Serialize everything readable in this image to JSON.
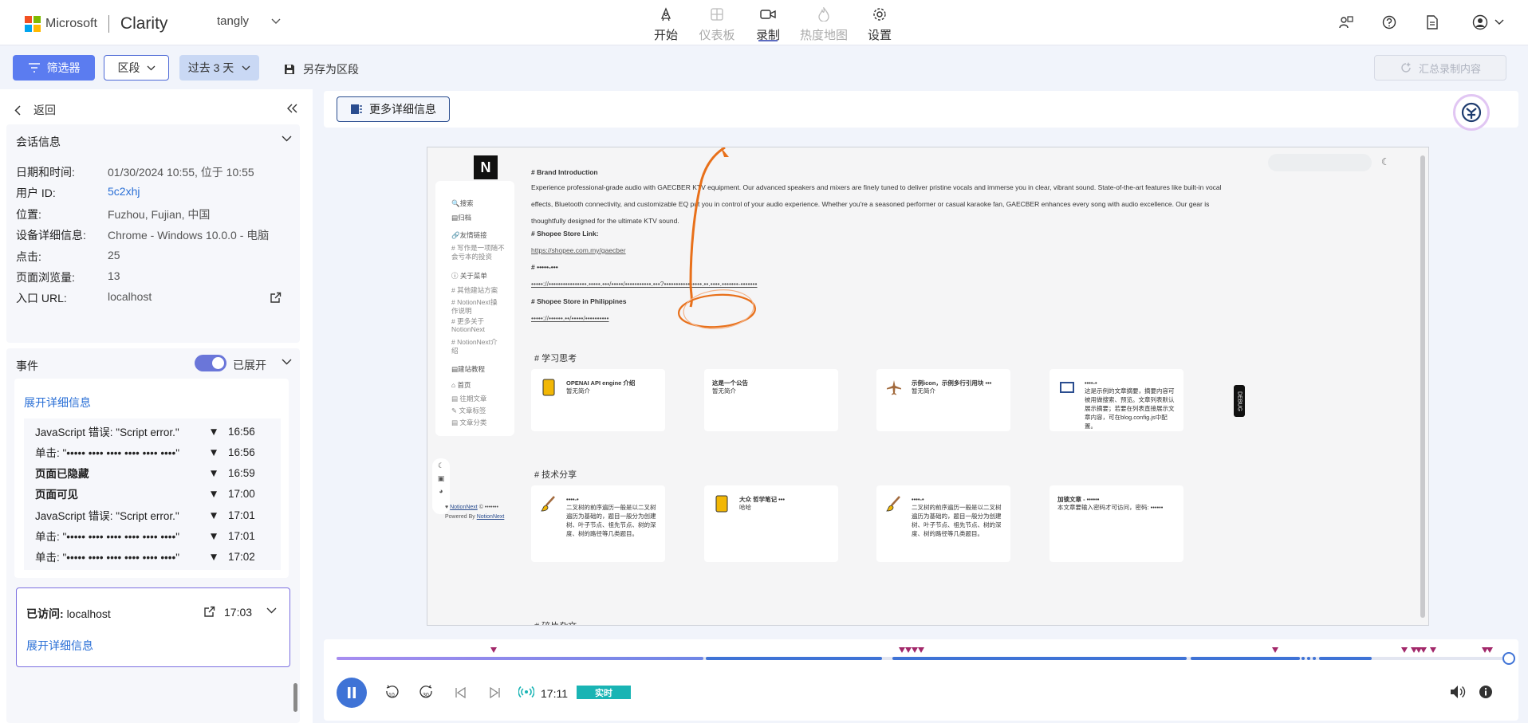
{
  "header": {
    "brand": "Microsoft",
    "product": "Clarity",
    "project": "tangly",
    "nav": [
      {
        "label": "开始",
        "icon": "rocket-icon",
        "state": "normal"
      },
      {
        "label": "仪表板",
        "icon": "dashboard-icon",
        "state": "disabled"
      },
      {
        "label": "录制",
        "icon": "video-icon",
        "state": "active"
      },
      {
        "label": "热度地图",
        "icon": "flame-icon",
        "state": "disabled"
      },
      {
        "label": "设置",
        "icon": "gear-icon",
        "state": "normal"
      }
    ]
  },
  "toolbar": {
    "filter": "筛选器",
    "segment": "区段",
    "range": "过去 3 天",
    "save_segment": "另存为区段",
    "summarize": "汇总录制内容"
  },
  "sidebar": {
    "back": "返回",
    "session_title": "会话信息",
    "session": [
      {
        "k": "日期和时间:",
        "v": "01/30/2024 10:55, 位于 10:55",
        "link": false
      },
      {
        "k": "用户 ID:",
        "v": "5c2xhj",
        "link": true
      },
      {
        "k": "位置:",
        "v": "Fuzhou, Fujian, 中国",
        "link": false
      },
      {
        "k": "设备详细信息:",
        "v": "Chrome - Windows 10.0.0 - 电脑",
        "link": false
      },
      {
        "k": "点击:",
        "v": "25",
        "link": false
      },
      {
        "k": "页面浏览量:",
        "v": "13",
        "link": false
      },
      {
        "k": "入口 URL:",
        "v": "localhost",
        "link": false
      }
    ],
    "events_title": "事件",
    "toggle_label": "已展开",
    "expand_details": "展开详细信息",
    "events": [
      {
        "label": "JavaScript 错误:",
        "detail": " \"Script error.\"",
        "time": "16:56"
      },
      {
        "label": "单击:",
        "detail": " \"••••• •••• •••• •••• •••• ••••\"",
        "time": "16:56"
      },
      {
        "label": "页面已隐藏",
        "detail": "",
        "time": "16:59"
      },
      {
        "label": "页面可见",
        "detail": "",
        "time": "17:00"
      },
      {
        "label": "JavaScript 错误:",
        "detail": " \"Script error.\"",
        "time": "17:01"
      },
      {
        "label": "单击:",
        "detail": " \"••••• •••• •••• •••• •••• ••••\"",
        "time": "17:01"
      },
      {
        "label": "单击:",
        "detail": " \"••••• •••• •••• •••• •••• ••••\"",
        "time": "17:02"
      }
    ],
    "visited": {
      "label": "已访问:",
      "value": "localhost",
      "time": "17:03",
      "expand": "展开详细信息"
    }
  },
  "main": {
    "more_details": "更多详细信息"
  },
  "site": {
    "nav": [
      {
        "text": "🔍搜索",
        "sub": false
      },
      {
        "text": "▤归档",
        "sub": false
      },
      {
        "text": "🔗友情链接",
        "sub": false
      },
      {
        "text": "# 写作是一项随不",
        "sub": true
      },
      {
        "text": "会亏本的投资",
        "sub": true
      },
      {
        "text": "ⓘ 关于菜单",
        "sub": false
      },
      {
        "text": "# 其他建站方案",
        "sub": true
      },
      {
        "text": "# NotionNext操",
        "sub": true
      },
      {
        "text": "作说明",
        "sub": true
      },
      {
        "text": "# 更多关于",
        "sub": true
      },
      {
        "text": "NotionNext",
        "sub": true
      },
      {
        "text": "# NotionNext介",
        "sub": true
      },
      {
        "text": "绍",
        "sub": true
      },
      {
        "text": "▤建站教程",
        "sub": false
      },
      {
        "text": "⌂ 首页",
        "sub": false
      },
      {
        "text": "▤ 往期文章",
        "sub": true
      },
      {
        "text": "✎ 文章标签",
        "sub": true
      },
      {
        "text": "▤ 文章分类",
        "sub": true
      }
    ],
    "footer_brand": "NotionNext",
    "footer_copy": "© •••••••",
    "footer_powered": "Powered By",
    "footer_powered_link": "NotionNext",
    "brand_heading": "# Brand Introduction",
    "brand_para": "Experience professional-grade audio with GAECBER KTV equipment. Our advanced speakers and mixers are finely tuned to deliver pristine vocals and immerse you in clear, vibrant sound. State-of-the-art features like built-in vocal effects, Bluetooth connectivity, and customizable EQ put you in control of your audio experience. Whether you're a seasoned performer or casual karaoke fan, GAECBER enhances every song with audio excellence. Our gear is thoughtfully designed for the ultimate KTV sound.",
    "shopee_heading": "# Shopee Store Link:",
    "shopee_link": "https://shopee.com.my/gaecber",
    "masked_heading": "# •••••-•••",
    "masked_link": "•••••://••••••••••••••••.•••••.•••/•••••/•••••••••••.•••?••••••••••••••••.••.••••.•••••••-•••••••",
    "ph_heading": "# Shopee Store in Philippines",
    "ph_link": "•••••://••••••.••/•••••/••••••••••",
    "section1": "# 学习思考",
    "section2": "# 技术分享",
    "section3": "# 碎片杂文",
    "cards1": [
      {
        "title": "OPENAI API engine 介绍",
        "sub": "暂无简介",
        "icon": "book-yellow-icon"
      },
      {
        "title": "这是一个公告",
        "sub": "暂无简介",
        "icon": ""
      },
      {
        "title": "示例icon，示例多行引用块 •••",
        "sub": "暂无简介",
        "icon": "airplane-icon"
      },
      {
        "title": "••••-•",
        "sub": "这是示例的文章摘要，摘要内容可被用做搜索、预览。文章列表默认展示摘要；若要在列表直接展示文章内容，可在blog.config.js中配置。",
        "icon": "open-book-icon"
      }
    ],
    "cards2": [
      {
        "title": "••••-•",
        "sub": "二叉树的前序遍历一般是以二叉树遍历为基础的，题目一般分为创建树、叶子节点、祖先节点、树的深度、树的路径等几类题目。",
        "icon": "brush-icon"
      },
      {
        "title": "大众 哲学笔记 •••",
        "sub": "哈哈",
        "icon": "book-yellow-icon"
      },
      {
        "title": "••••-•",
        "sub": "二叉树的前序遍历一般是以二叉树遍历为基础的，题目一般分为创建树、叶子节点、祖先节点、树的深度、树的路径等几类题目。",
        "icon": "brush-icon"
      },
      {
        "title": "加锁文章 - ••••••",
        "sub": "本文章要输入密码才可访问，密码: ••••••",
        "icon": ""
      }
    ],
    "debug": "DEBUG"
  },
  "player": {
    "current_time": "17:11",
    "live": "实时"
  },
  "colors": {
    "accent": "#5b7cf0",
    "timeline": "#3f73d6",
    "marker": "#a2286a",
    "live": "#19b4b4",
    "annotation": "#e8701a"
  }
}
